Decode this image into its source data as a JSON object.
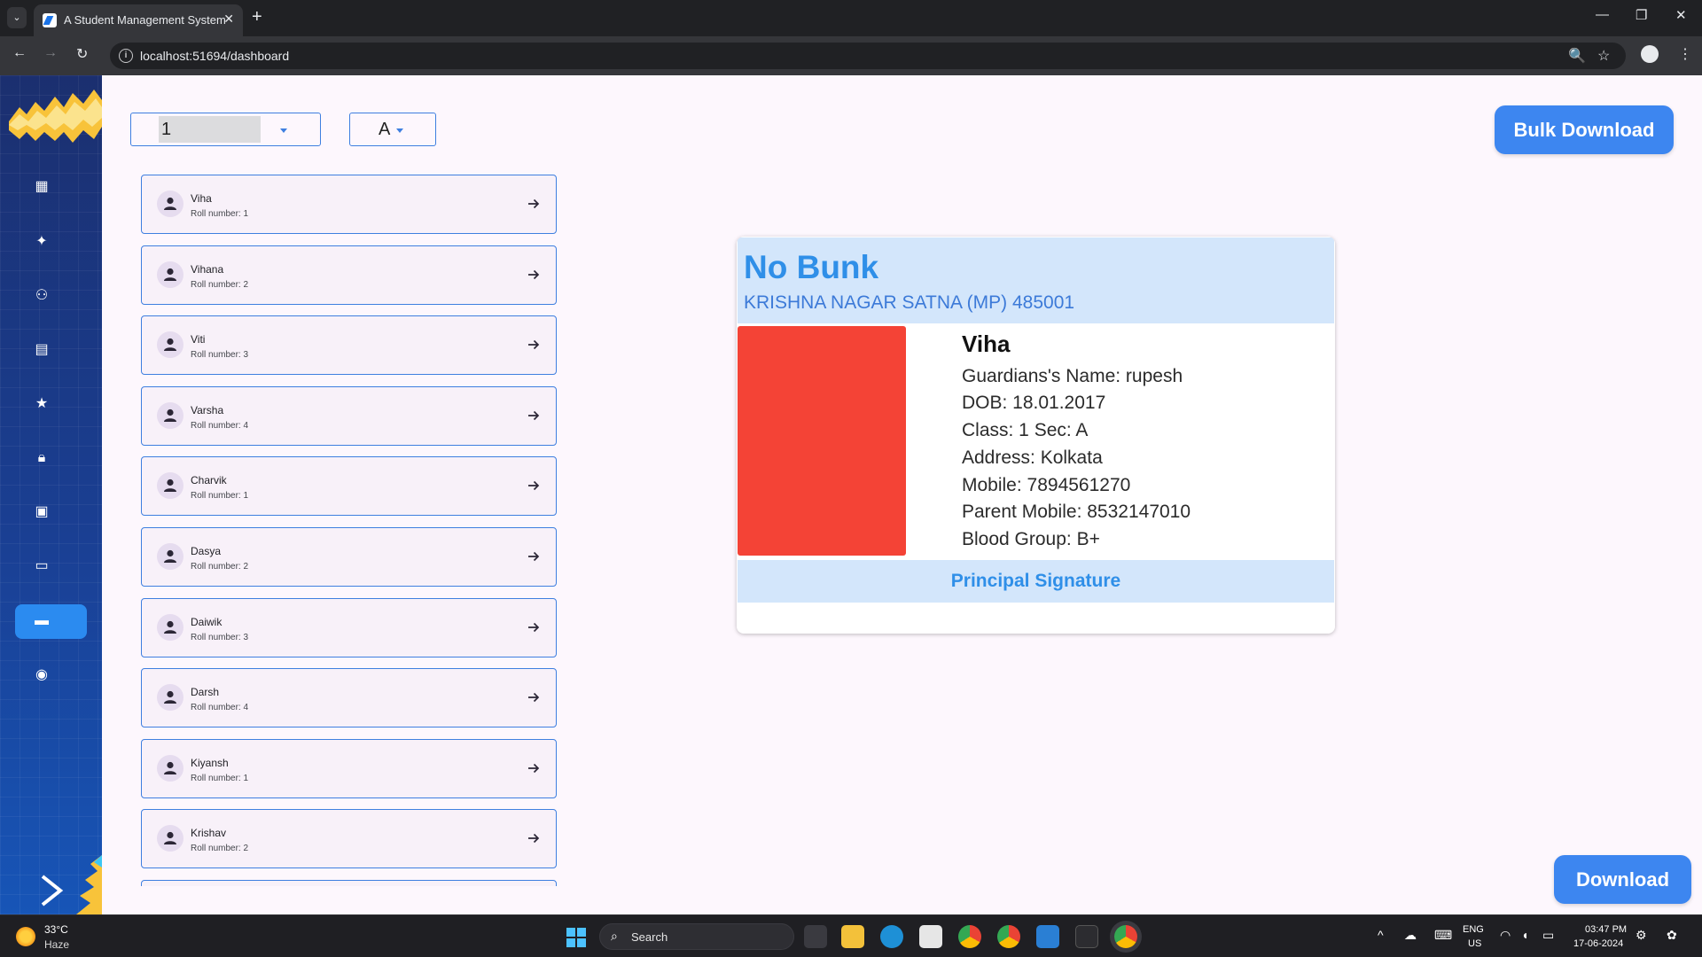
{
  "browser": {
    "tab_title": "A Student Management System",
    "url": "localhost:51694/dashboard"
  },
  "filters": {
    "class_value": "1",
    "section_value": "A"
  },
  "actions": {
    "bulk_download": "Bulk Download",
    "download": "Download"
  },
  "students": [
    {
      "name": "Viha",
      "roll": "Roll number: 1"
    },
    {
      "name": "Vihana",
      "roll": "Roll number: 2"
    },
    {
      "name": "Viti",
      "roll": "Roll number: 3"
    },
    {
      "name": "Varsha",
      "roll": "Roll number: 4"
    },
    {
      "name": "Charvik",
      "roll": "Roll number: 1"
    },
    {
      "name": "Dasya",
      "roll": "Roll number: 2"
    },
    {
      "name": "Daiwik",
      "roll": "Roll number: 3"
    },
    {
      "name": "Darsh",
      "roll": "Roll number: 4"
    },
    {
      "name": "Kiyansh",
      "roll": "Roll number: 1"
    },
    {
      "name": "Krishav",
      "roll": "Roll number: 2"
    }
  ],
  "id_card": {
    "school_name": "No Bunk",
    "school_address": "KRISHNA NAGAR SATNA (MP) 485001",
    "student_name": "Viha",
    "guardian": "Guardians's Name: rupesh",
    "dob": "DOB: 18.01.2017",
    "class_sec": "Class: 1  Sec: A",
    "address": "Address: Kolkata",
    "mobile": "Mobile: 7894561270",
    "parent_mobile": "Parent Mobile: 8532147010",
    "blood_group": "Blood Group: B+",
    "signature": "Principal Signature",
    "photo_color": "#f44336"
  },
  "sidebar": {
    "icons": [
      "dashboard-icon",
      "student-icon",
      "teacher-icon",
      "report-icon",
      "star-icon",
      "lock-icon",
      "attendance-icon",
      "fees-icon",
      "id-card-icon",
      "settings-icon"
    ],
    "active_index": 8,
    "accent": "#2b8bf0"
  },
  "taskbar": {
    "temperature": "33°C",
    "weather": "Haze",
    "search": "Search",
    "lang": "ENG",
    "region": "US",
    "time": "03:47 PM",
    "date": "17-06-2024"
  },
  "colors": {
    "primary": "#3d86f0",
    "card_header": "#d3e6fb",
    "school_text": "#2f8fe8"
  }
}
